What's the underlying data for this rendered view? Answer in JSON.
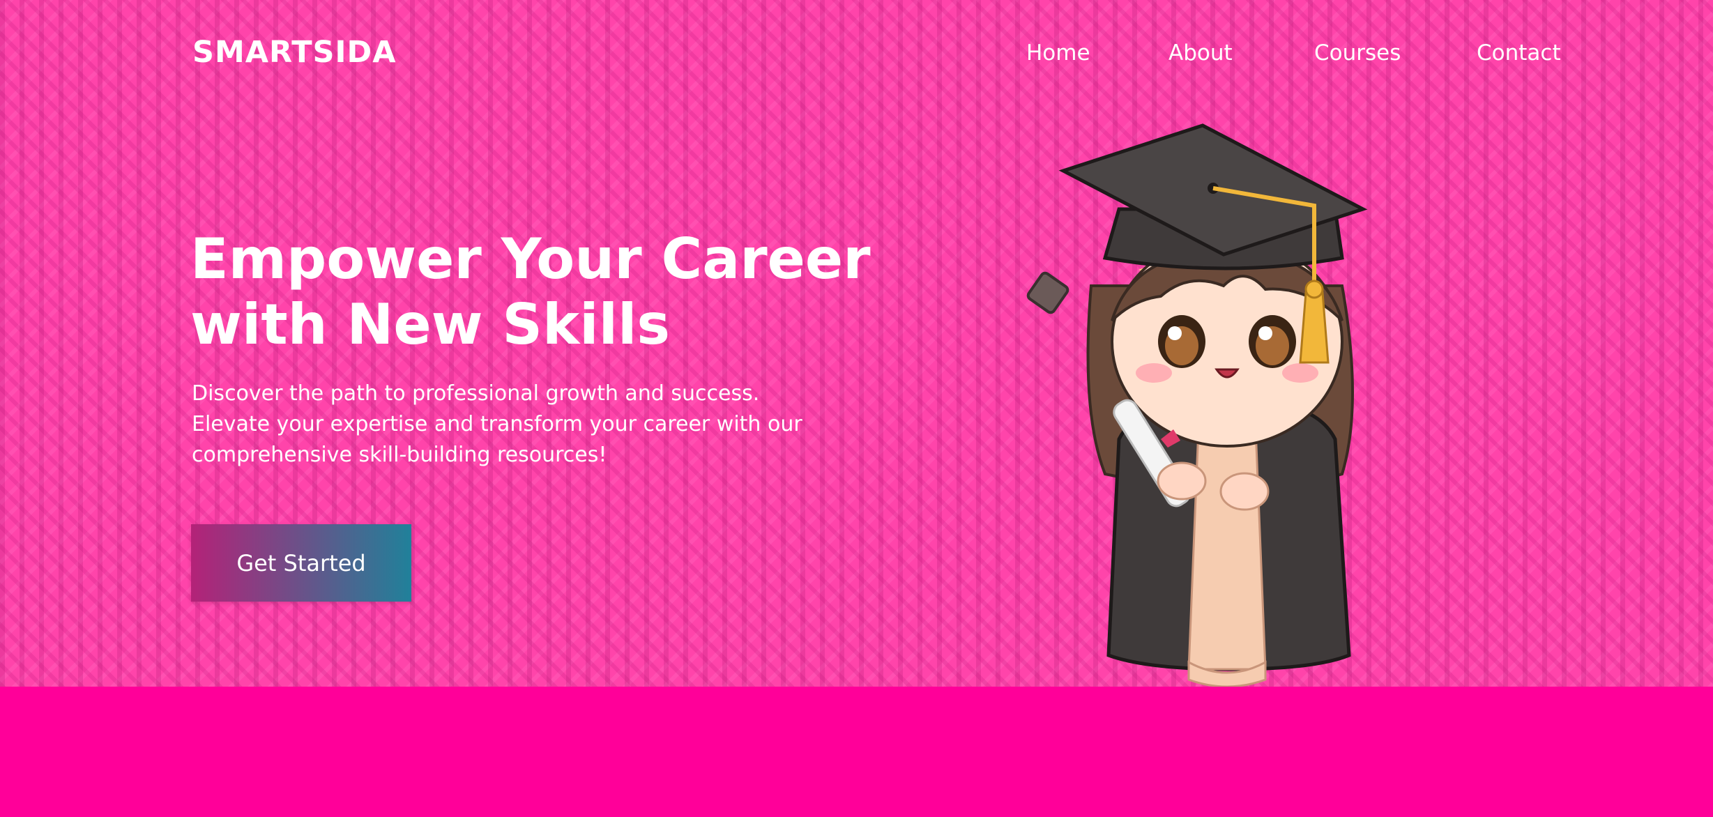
{
  "header": {
    "logo": "SMARTSIDA",
    "nav": [
      {
        "label": "Home"
      },
      {
        "label": "About"
      },
      {
        "label": "Courses"
      },
      {
        "label": "Contact"
      }
    ]
  },
  "hero": {
    "headline_line1": "Empower Your Career",
    "headline_line2": "with New Skills",
    "subtext_line1": "Discover the path to professional growth and success.",
    "subtext_line2": "Elevate your expertise and transform your career with our",
    "subtext_line3": "comprehensive skill-building resources!",
    "cta_label": "Get Started",
    "illustration": "graduate-girl-illustration"
  },
  "colors": {
    "hero_background": "#ff44aa",
    "footer_band": "#ff0099",
    "button_gradient_start": "#b42278",
    "button_gradient_end": "#20819a",
    "text": "#ffffff"
  }
}
